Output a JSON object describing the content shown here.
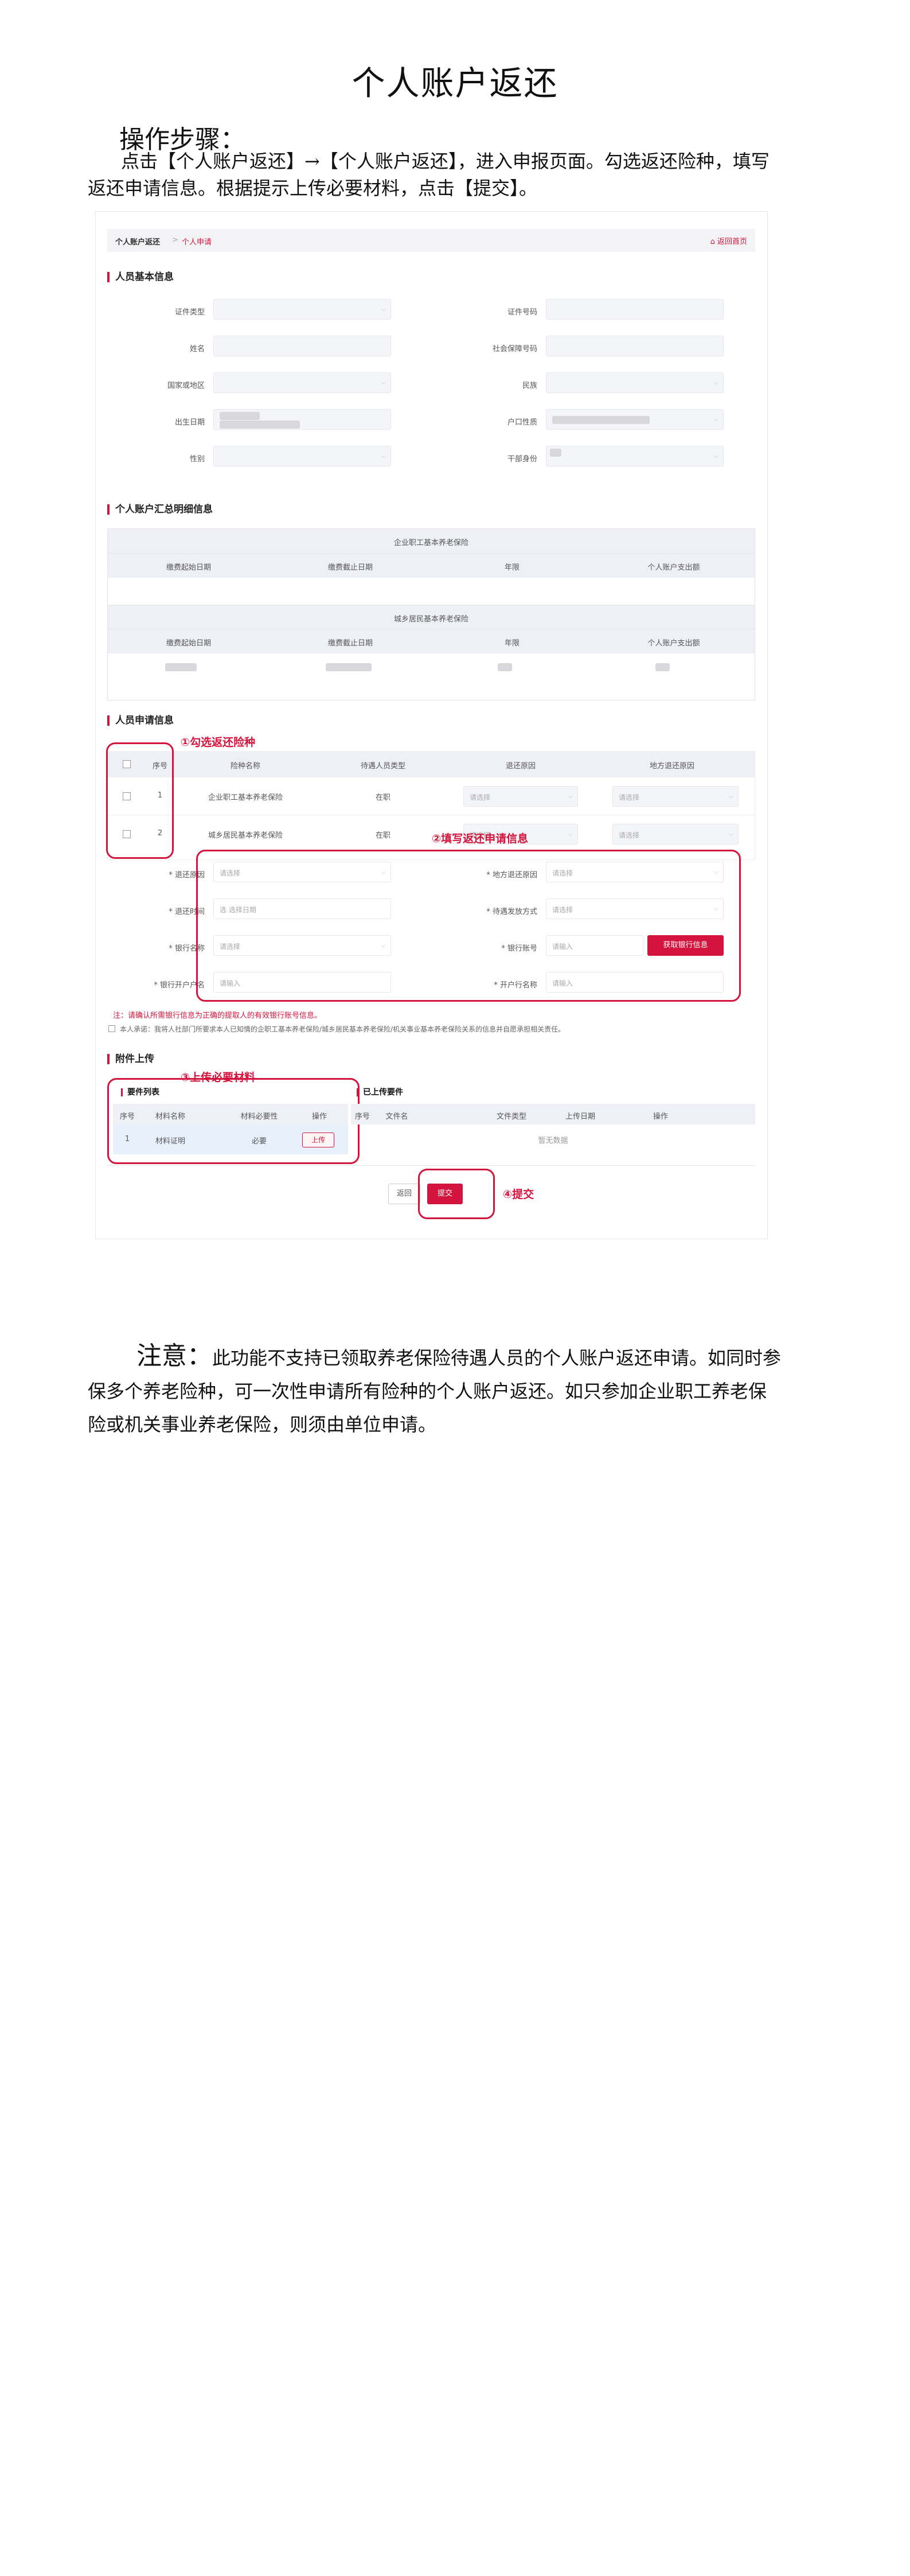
{
  "document": {
    "title": "个人账户返还",
    "steps_heading": "操作步骤：",
    "steps_text": "点击【个人账户返还】→【个人账户返还】，进入申报页面。勾选返还险种，填写返还申请信息。根据提示上传必要材料，点击【提交】。",
    "note_label": "注意：",
    "note_text": "此功能不支持已领取养老保险待遇人员的个人账户返还申请。如同时参保多个养老险种，可一次性申请所有险种的个人账户返还。如只参加企业职工养老保险或机关事业养老保险，则须由单位申请。"
  },
  "screenshot": {
    "breadcrumb": {
      "root": "个人账户返还",
      "separator": ">",
      "current": "个人申请",
      "home": "返回首页"
    },
    "basic_info": {
      "heading": "人员基本信息",
      "fields_left": [
        "证件类型",
        "姓名",
        "国家或地区",
        "出生日期",
        "性别"
      ],
      "fields_right": [
        "证件号码",
        "社会保障号码",
        "民族",
        "户口性质",
        "干部身份"
      ]
    },
    "account_summary": {
      "heading": "个人账户汇总明细信息",
      "group1_title": "企业职工基本养老保险",
      "group2_title": "城乡居民基本养老保险",
      "columns": [
        "缴费起始日期",
        "缴费截止日期",
        "年限",
        "个人账户支出额"
      ]
    },
    "apply_info": {
      "heading": "人员申请信息",
      "columns": [
        "序号",
        "险种名称",
        "待遇人员类型",
        "退还原因",
        "地方退还原因"
      ],
      "rows": [
        {
          "no": "1",
          "name": "企业职工基本养老保险",
          "type": "在职",
          "reason": "请选择",
          "local": "请选择"
        },
        {
          "no": "2",
          "name": "城乡居民基本养老保险",
          "type": "在职",
          "reason": "请选择",
          "local": "请选择"
        }
      ],
      "form": {
        "refund_reason": "* 退还原因",
        "local_reason": "* 地方退还原因",
        "refund_time": "* 退还时间",
        "pay_method": "* 待遇发放方式",
        "bank_name": "* 银行名称",
        "bank_account": "* 银行账号",
        "account_holder": "* 银行开户户名",
        "branch_name": "* 开户行名称",
        "placeholder_select": "请选择",
        "placeholder_date": "选 选择日期",
        "placeholder_input": "请输入",
        "fetch_bank": "获取银行信息"
      },
      "warning": "注：请确认所需银行信息为正确的提取人的有效银行账号信息。",
      "promise": "本人承诺：我将人社部门所要求本人已知情的企职工基本养老保险/城乡居民基本养老保险/机关事业基本养老保险关系的信息并自愿承担相关责任。"
    },
    "attachments": {
      "heading": "附件上传",
      "req_list": "要件列表",
      "uploaded_list": "已上传要件",
      "req_columns": [
        "序号",
        "材料名称",
        "材料必要性",
        "操作"
      ],
      "req_row": {
        "no": "1",
        "name": "材料证明",
        "need": "必要",
        "op": "上传"
      },
      "up_columns": [
        "序号",
        "文件名",
        "文件类型",
        "上传日期",
        "操作"
      ],
      "empty": "暂无数据"
    },
    "actions": {
      "back": "返回",
      "submit": "提交"
    },
    "annotations": {
      "a1": "①勾选返还险种",
      "a2": "②填写返还申请信息",
      "a3": "③上传必要材料",
      "a4": "④提交"
    },
    "accent_color": "#d4143c"
  }
}
